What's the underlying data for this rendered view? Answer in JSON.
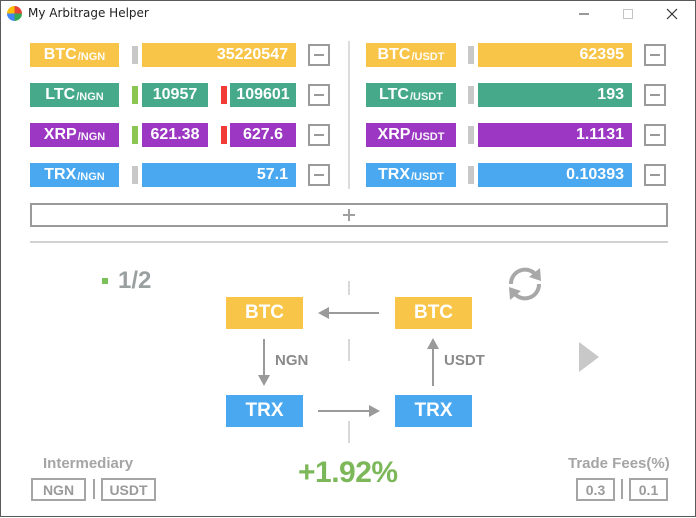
{
  "window": {
    "title": "My Arbitrage Helper"
  },
  "pairs_left": [
    {
      "base": "BTC",
      "quote": "/NGN",
      "value": "35220547",
      "color": "#f8c549"
    },
    {
      "base": "LTC",
      "quote": "/NGN",
      "bid": "10957",
      "ask": "109601",
      "color": "#45a98a"
    },
    {
      "base": "XRP",
      "quote": "/NGN",
      "bid": "621.38",
      "ask": "627.6",
      "color": "#9b37c2"
    },
    {
      "base": "TRX",
      "quote": "/NGN",
      "value": "57.1",
      "color": "#4aa8f0"
    }
  ],
  "pairs_right": [
    {
      "base": "BTC",
      "quote": "/USDT",
      "value": "62395",
      "color": "#f8c549"
    },
    {
      "base": "LTC",
      "quote": "/USDT",
      "value": "193",
      "color": "#45a98a"
    },
    {
      "base": "XRP",
      "quote": "/USDT",
      "value": "1.1131",
      "color": "#9b37c2"
    },
    {
      "base": "TRX",
      "quote": "/USDT",
      "value": "0.10393",
      "color": "#4aa8f0"
    }
  ],
  "route": {
    "page": "1/2",
    "top_left": "BTC",
    "top_right": "BTC",
    "bottom_left": "TRX",
    "bottom_right": "TRX",
    "left_edge_label": "NGN",
    "right_edge_label": "USDT",
    "profit": "+1.92%"
  },
  "intermediary": {
    "label": "Intermediary",
    "options": [
      "NGN",
      "USDT"
    ]
  },
  "fees": {
    "label": "Trade Fees(%)",
    "values": [
      "0.3",
      "0.1"
    ]
  },
  "icons": {
    "app": "app-logo-icon",
    "refresh": "refresh-icon",
    "next": "play-next-icon"
  },
  "colors": {
    "btc": "#f8c549",
    "ltc": "#45a98a",
    "xrp": "#9b37c2",
    "trx": "#4aa8f0",
    "bid_indicator": "#8bc653",
    "ask_indicator": "#f03b36",
    "profit": "#7cb85a"
  }
}
